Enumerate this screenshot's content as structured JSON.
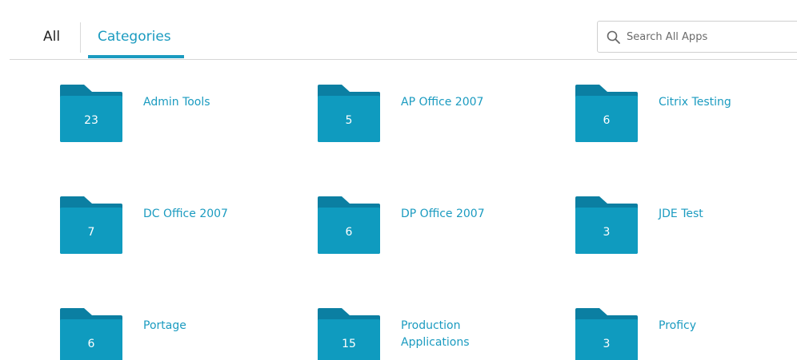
{
  "tabs": {
    "all_label": "All",
    "categories_label": "Categories"
  },
  "search": {
    "placeholder": "Search All Apps",
    "icon": "search-icon"
  },
  "colors": {
    "accent": "#1b9bc0",
    "folder": "#0f9bbf",
    "folder_tab": "#0b7fa2"
  },
  "categories": [
    {
      "label": "Admin Tools",
      "count": "23"
    },
    {
      "label": "AP Office 2007",
      "count": "5"
    },
    {
      "label": "Citrix Testing",
      "count": "6"
    },
    {
      "label": "DC Office 2007",
      "count": "7"
    },
    {
      "label": "DP Office 2007",
      "count": "6"
    },
    {
      "label": "JDE Test",
      "count": "3"
    },
    {
      "label": "Portage",
      "count": "6"
    },
    {
      "label": "Production Applications",
      "count": "15"
    },
    {
      "label": "Proficy",
      "count": "3"
    }
  ]
}
